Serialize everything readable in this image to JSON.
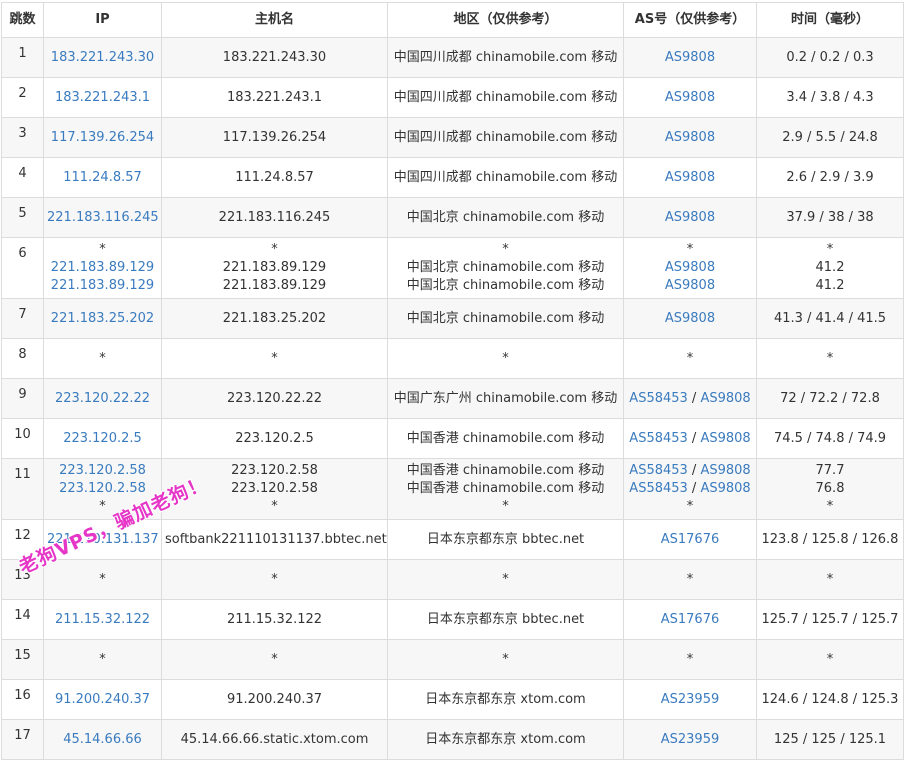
{
  "headers": [
    "跳数",
    "IP",
    "主机名",
    "地区（仅供参考）",
    "AS号（仅供参考）",
    "时间（毫秒）"
  ],
  "rows": [
    {
      "hop": "1",
      "ip": [
        "183.221.243.30"
      ],
      "host": [
        "183.221.243.30"
      ],
      "region": [
        "中国四川成都 chinamobile.com 移动"
      ],
      "as": [
        [
          "AS9808"
        ]
      ],
      "time": [
        "0.2 / 0.2 / 0.3"
      ]
    },
    {
      "hop": "2",
      "ip": [
        "183.221.243.1"
      ],
      "host": [
        "183.221.243.1"
      ],
      "region": [
        "中国四川成都 chinamobile.com 移动"
      ],
      "as": [
        [
          "AS9808"
        ]
      ],
      "time": [
        "3.4 / 3.8 / 4.3"
      ]
    },
    {
      "hop": "3",
      "ip": [
        "117.139.26.254"
      ],
      "host": [
        "117.139.26.254"
      ],
      "region": [
        "中国四川成都 chinamobile.com 移动"
      ],
      "as": [
        [
          "AS9808"
        ]
      ],
      "time": [
        "2.9 / 5.5 / 24.8"
      ]
    },
    {
      "hop": "4",
      "ip": [
        "111.24.8.57"
      ],
      "host": [
        "111.24.8.57"
      ],
      "region": [
        "中国四川成都 chinamobile.com 移动"
      ],
      "as": [
        [
          "AS9808"
        ]
      ],
      "time": [
        "2.6 / 2.9 / 3.9"
      ]
    },
    {
      "hop": "5",
      "ip": [
        "221.183.116.245"
      ],
      "host": [
        "221.183.116.245"
      ],
      "region": [
        "中国北京 chinamobile.com 移动"
      ],
      "as": [
        [
          "AS9808"
        ]
      ],
      "time": [
        "37.9 / 38 / 38"
      ]
    },
    {
      "hop": "6",
      "ip": [
        "*",
        "221.183.89.129",
        "221.183.89.129"
      ],
      "host": [
        "*",
        "221.183.89.129",
        "221.183.89.129"
      ],
      "region": [
        "*",
        "中国北京 chinamobile.com 移动",
        "中国北京 chinamobile.com 移动"
      ],
      "as": [
        [
          "*"
        ],
        [
          "AS9808"
        ],
        [
          "AS9808"
        ]
      ],
      "time": [
        "*",
        "41.2",
        "41.2"
      ]
    },
    {
      "hop": "7",
      "ip": [
        "221.183.25.202"
      ],
      "host": [
        "221.183.25.202"
      ],
      "region": [
        "中国北京 chinamobile.com 移动"
      ],
      "as": [
        [
          "AS9808"
        ]
      ],
      "time": [
        "41.3 / 41.4 / 41.5"
      ]
    },
    {
      "hop": "8",
      "ip": [
        "*"
      ],
      "host": [
        "*"
      ],
      "region": [
        "*"
      ],
      "as": [
        [
          "*"
        ]
      ],
      "time": [
        "*"
      ]
    },
    {
      "hop": "9",
      "ip": [
        "223.120.22.22"
      ],
      "host": [
        "223.120.22.22"
      ],
      "region": [
        "中国广东广州 chinamobile.com 移动"
      ],
      "as": [
        [
          "AS58453",
          "AS9808"
        ]
      ],
      "time": [
        "72 / 72.2 / 72.8"
      ]
    },
    {
      "hop": "10",
      "ip": [
        "223.120.2.5"
      ],
      "host": [
        "223.120.2.5"
      ],
      "region": [
        "中国香港 chinamobile.com 移动"
      ],
      "as": [
        [
          "AS58453",
          "AS9808"
        ]
      ],
      "time": [
        "74.5 / 74.8 / 74.9"
      ]
    },
    {
      "hop": "11",
      "ip": [
        "223.120.2.58",
        "223.120.2.58",
        "*"
      ],
      "host": [
        "223.120.2.58",
        "223.120.2.58",
        "*"
      ],
      "region": [
        "中国香港 chinamobile.com 移动",
        "中国香港 chinamobile.com 移动",
        "*"
      ],
      "as": [
        [
          "AS58453",
          "AS9808"
        ],
        [
          "AS58453",
          "AS9808"
        ],
        [
          "*"
        ]
      ],
      "time": [
        "77.7",
        "76.8",
        "*"
      ]
    },
    {
      "hop": "12",
      "ip": [
        "221.110.131.137"
      ],
      "host": [
        "softbank221110131137.bbtec.net"
      ],
      "region": [
        "日本东京都东京 bbtec.net"
      ],
      "as": [
        [
          "AS17676"
        ]
      ],
      "time": [
        "123.8 / 125.8 / 126.8"
      ]
    },
    {
      "hop": "13",
      "ip": [
        "*"
      ],
      "host": [
        "*"
      ],
      "region": [
        "*"
      ],
      "as": [
        [
          "*"
        ]
      ],
      "time": [
        "*"
      ]
    },
    {
      "hop": "14",
      "ip": [
        "211.15.32.122"
      ],
      "host": [
        "211.15.32.122"
      ],
      "region": [
        "日本东京都东京 bbtec.net"
      ],
      "as": [
        [
          "AS17676"
        ]
      ],
      "time": [
        "125.7 / 125.7 / 125.7"
      ]
    },
    {
      "hop": "15",
      "ip": [
        "*"
      ],
      "host": [
        "*"
      ],
      "region": [
        "*"
      ],
      "as": [
        [
          "*"
        ]
      ],
      "time": [
        "*"
      ]
    },
    {
      "hop": "16",
      "ip": [
        "91.200.240.37"
      ],
      "host": [
        "91.200.240.37"
      ],
      "region": [
        "日本东京都东京 xtom.com"
      ],
      "as": [
        [
          "AS23959"
        ]
      ],
      "time": [
        "124.6 / 124.8 / 125.3"
      ]
    },
    {
      "hop": "17",
      "ip": [
        "45.14.66.66"
      ],
      "host": [
        "45.14.66.66.static.xtom.com"
      ],
      "region": [
        "日本东京都东京 xtom.com"
      ],
      "as": [
        [
          "AS23959"
        ]
      ],
      "time": [
        "125 / 125 / 125.1"
      ]
    }
  ],
  "watermark": "老狗VPS，骗加老狗！",
  "colors": {
    "link": "#3a7bbf",
    "border": "#dcdcdc",
    "stripe": "#f7f7f7",
    "watermark": "#e636c8"
  }
}
